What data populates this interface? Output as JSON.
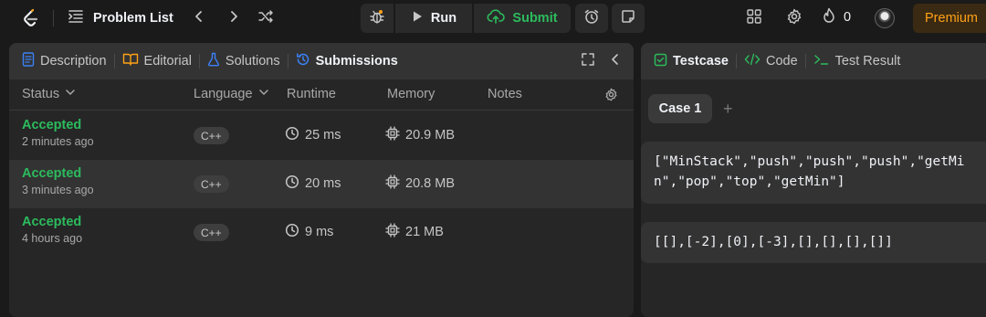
{
  "topbar": {
    "logo_icon": "leetcode-logo-icon",
    "problem_list_label": "Problem List",
    "run_label": "Run",
    "submit_label": "Submit",
    "streak_count": "0",
    "premium_label": "Premium"
  },
  "left_tabs": {
    "description": "Description",
    "editorial": "Editorial",
    "solutions": "Solutions",
    "submissions": "Submissions"
  },
  "table": {
    "headers": {
      "status": "Status",
      "language": "Language",
      "runtime": "Runtime",
      "memory": "Memory",
      "notes": "Notes"
    },
    "rows": [
      {
        "status": "Accepted",
        "time": "2 minutes ago",
        "language": "C++",
        "runtime": "25 ms",
        "memory": "20.9 MB"
      },
      {
        "status": "Accepted",
        "time": "3 minutes ago",
        "language": "C++",
        "runtime": "20 ms",
        "memory": "20.8 MB"
      },
      {
        "status": "Accepted",
        "time": "4 hours ago",
        "language": "C++",
        "runtime": "9 ms",
        "memory": "21 MB"
      }
    ]
  },
  "right_tabs": {
    "testcase": "Testcase",
    "code": "Code",
    "test_result": "Test Result"
  },
  "testcase": {
    "case_label": "Case 1",
    "add_label": "+",
    "input_1": "[\"MinStack\",\"push\",\"push\",\"push\",\"getMin\",\"pop\",\"top\",\"getMin\"]",
    "input_1_line1": "[\"MinStack\",\"push\",\"push\",\"push\",\"getMi",
    "input_1_line2": "n\",\"pop\",\"top\",\"getMin\"]",
    "input_2": "[[],[-2],[0],[-3],[],[],[],[]]"
  },
  "colors": {
    "accepted": "#2cbb5d",
    "submit": "#2cbb5d",
    "premium": "#ffa116",
    "active_tab_icon": "#3b82f6",
    "testcase_icon": "#2cbb5d"
  }
}
